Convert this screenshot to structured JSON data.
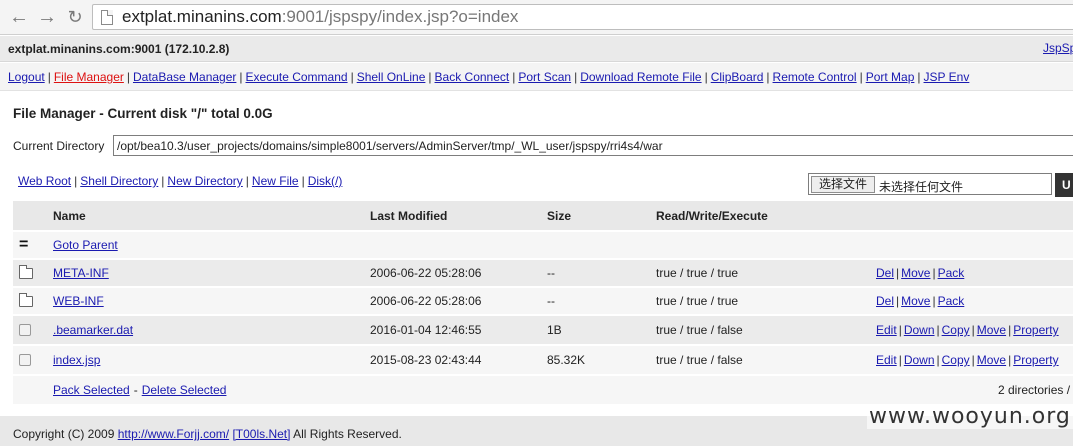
{
  "browser": {
    "url_host": "extplat.minanins.com",
    "url_rest": ":9001/jspspy/index.jsp?o=index"
  },
  "hostbar": {
    "host": "extplat.minanins.com:9001 (172.10.2.8)",
    "version_link": "JspSp"
  },
  "menu": [
    {
      "label": "Logout",
      "active": false
    },
    {
      "label": "File Manager",
      "active": true
    },
    {
      "label": "DataBase Manager",
      "active": false
    },
    {
      "label": "Execute Command",
      "active": false
    },
    {
      "label": "Shell OnLine",
      "active": false
    },
    {
      "label": "Back Connect",
      "active": false
    },
    {
      "label": "Port Scan",
      "active": false
    },
    {
      "label": "Download Remote File",
      "active": false
    },
    {
      "label": "ClipBoard",
      "active": false
    },
    {
      "label": "Remote Control",
      "active": false
    },
    {
      "label": "Port Map",
      "active": false
    },
    {
      "label": "JSP Env",
      "active": false
    }
  ],
  "title": "File Manager - Current disk \"/\" total 0.0G",
  "current_directory": {
    "label": "Current Directory",
    "value": "/opt/bea10.3/user_projects/domains/simple8001/servers/AdminServer/tmp/_WL_user/jspspy/rri4s4/war"
  },
  "actions": [
    "Web Root",
    "Shell Directory",
    "New Directory",
    "New File",
    "Disk(/)"
  ],
  "upload": {
    "choose_label": "选择文件",
    "no_file_text": "未选择任何文件",
    "button_label": "U"
  },
  "table": {
    "headers": {
      "name": "Name",
      "modified": "Last Modified",
      "size": "Size",
      "rwx": "Read/Write/Execute"
    },
    "parent_label": "Goto Parent",
    "parent_icon": "=",
    "rows": [
      {
        "type": "dir",
        "name": "META-INF",
        "modified": "2006-06-22 05:28:06",
        "size": "--",
        "rwx": "true / true / true",
        "actions": [
          "Del",
          "Move",
          "Pack"
        ]
      },
      {
        "type": "dir",
        "name": "WEB-INF",
        "modified": "2006-06-22 05:28:06",
        "size": "--",
        "rwx": "true / true / true",
        "actions": [
          "Del",
          "Move",
          "Pack"
        ]
      },
      {
        "type": "file",
        "name": ".beamarker.dat",
        "modified": "2016-01-04 12:46:55",
        "size": "1B",
        "rwx": "true / true / false",
        "actions": [
          "Edit",
          "Down",
          "Copy",
          "Move",
          "Property"
        ]
      },
      {
        "type": "file",
        "name": "index.jsp",
        "modified": "2015-08-23 02:43:44",
        "size": "85.32K",
        "rwx": "true / true / false",
        "actions": [
          "Edit",
          "Down",
          "Copy",
          "Move",
          "Property"
        ]
      }
    ],
    "footer_actions": {
      "pack": "Pack Selected",
      "separator": "-",
      "delete": "Delete Selected"
    },
    "summary": "2 directories /"
  },
  "footer": {
    "prefix": "Copyright (C) 2009",
    "link1": "http://www.Forjj.com/",
    "link2": "[T00ls.Net]",
    "suffix": "All Rights Reserved."
  },
  "watermark": "www.wooyun.org"
}
